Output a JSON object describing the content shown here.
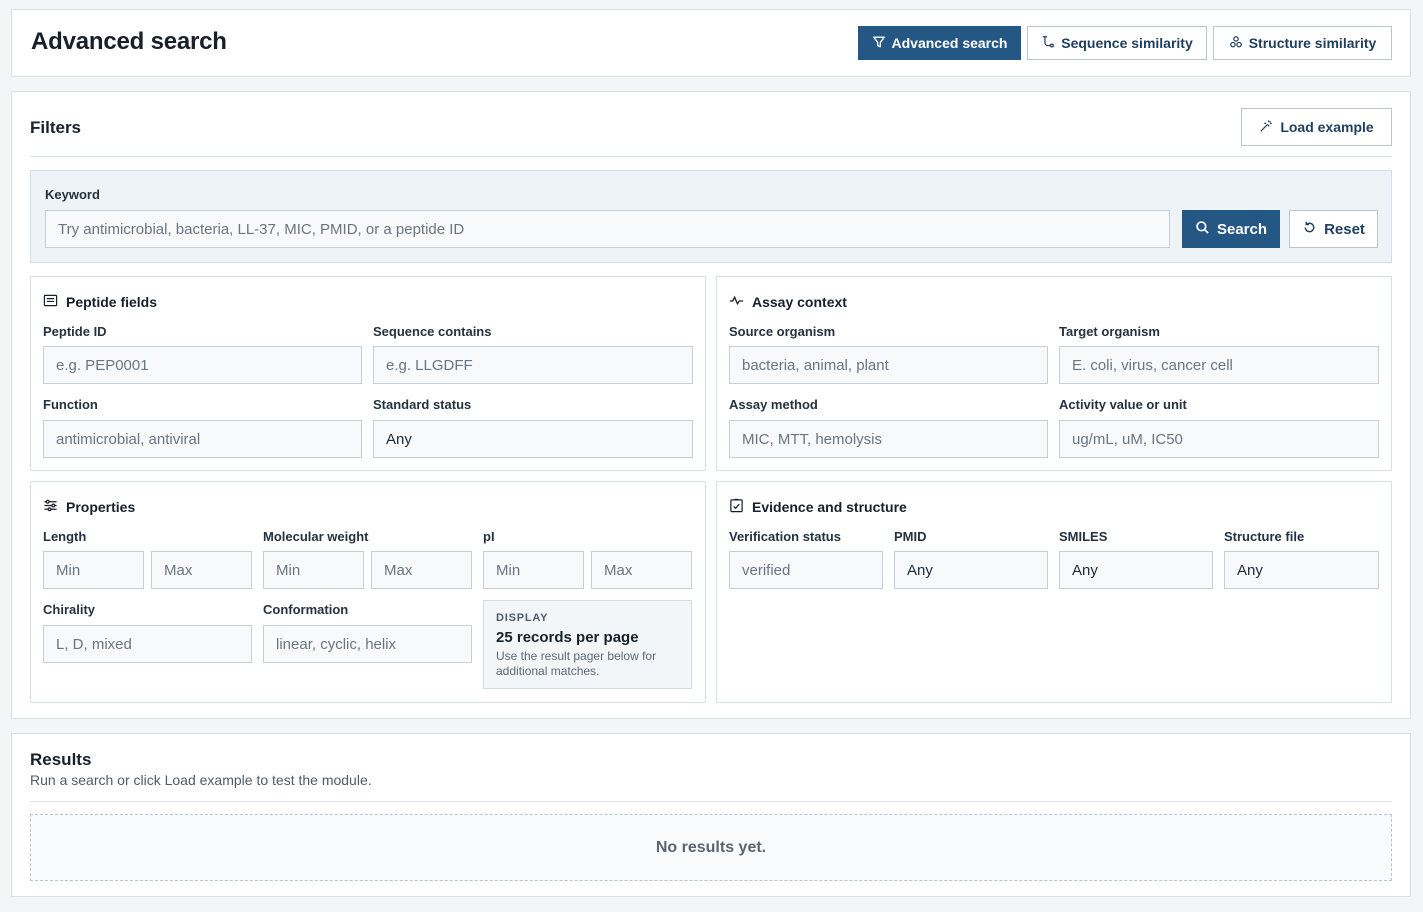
{
  "header": {
    "title": "Advanced search",
    "tabs": [
      {
        "label": "Advanced search",
        "icon": "filter-icon",
        "active": true
      },
      {
        "label": "Sequence similarity",
        "icon": "sequence-icon",
        "active": false
      },
      {
        "label": "Structure similarity",
        "icon": "molecule-icon",
        "active": false
      }
    ]
  },
  "filters": {
    "title": "Filters",
    "load_example": "Load example",
    "keyword": {
      "label": "Keyword",
      "placeholder": "Try antimicrobial, bacteria, LL-37, MIC, PMID, or a peptide ID",
      "search": "Search",
      "reset": "Reset"
    },
    "peptide_fields": {
      "title": "Peptide fields",
      "peptide_id": {
        "label": "Peptide ID",
        "placeholder": "e.g. PEP0001"
      },
      "sequence": {
        "label": "Sequence contains",
        "placeholder": "e.g. LLGDFF"
      },
      "function": {
        "label": "Function",
        "placeholder": "antimicrobial, antiviral"
      },
      "standard_status": {
        "label": "Standard status",
        "value": "Any"
      }
    },
    "assay_context": {
      "title": "Assay context",
      "source": {
        "label": "Source organism",
        "placeholder": "bacteria, animal, plant"
      },
      "target": {
        "label": "Target organism",
        "placeholder": "E. coli, virus, cancer cell"
      },
      "method": {
        "label": "Assay method",
        "placeholder": "MIC, MTT, hemolysis"
      },
      "activity": {
        "label": "Activity value or unit",
        "placeholder": "ug/mL, uM, IC50"
      }
    },
    "properties": {
      "title": "Properties",
      "length": {
        "label": "Length",
        "min": "Min",
        "max": "Max"
      },
      "mw": {
        "label": "Molecular weight",
        "min": "Min",
        "max": "Max"
      },
      "pi": {
        "label": "pI",
        "min": "Min",
        "max": "Max"
      },
      "chirality": {
        "label": "Chirality",
        "placeholder": "L, D, mixed"
      },
      "conformation": {
        "label": "Conformation",
        "placeholder": "linear, cyclic, helix"
      },
      "display": {
        "kicker": "DISPLAY",
        "value": "25 records per page",
        "note": "Use the result pager below for additional matches."
      }
    },
    "evidence": {
      "title": "Evidence and structure",
      "verification": {
        "label": "Verification status",
        "placeholder": "verified"
      },
      "pmid": {
        "label": "PMID",
        "value": "Any"
      },
      "smiles": {
        "label": "SMILES",
        "value": "Any"
      },
      "structure_file": {
        "label": "Structure file",
        "value": "Any"
      }
    }
  },
  "results": {
    "title": "Results",
    "subtitle": "Run a search or click Load example to test the module.",
    "empty": "No results yet."
  }
}
